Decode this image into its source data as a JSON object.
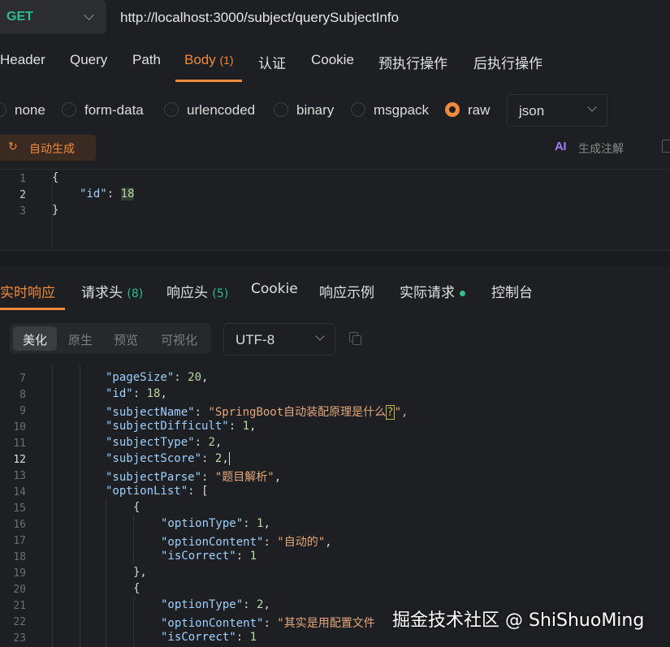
{
  "request": {
    "method": "GET",
    "url": "http://localhost:3000/subject/querySubjectInfo"
  },
  "req_tabs": [
    {
      "label": "Header"
    },
    {
      "label": "Query"
    },
    {
      "label": "Path"
    },
    {
      "label": "Body",
      "count": "(1)",
      "active": true
    },
    {
      "label": "认证"
    },
    {
      "label": "Cookie"
    },
    {
      "label": "预执行操作"
    },
    {
      "label": "后执行操作"
    }
  ],
  "body_types": [
    {
      "label": "none"
    },
    {
      "label": "form-data"
    },
    {
      "label": "urlencoded"
    },
    {
      "label": "binary"
    },
    {
      "label": "msgpack"
    },
    {
      "label": "raw",
      "selected": true
    }
  ],
  "raw_format": "json",
  "auto_generate_label": "自动生成",
  "ai": {
    "icon_text": "AI",
    "label": "生成注解"
  },
  "request_body": {
    "line_numbers": [
      "1",
      "2",
      "3"
    ],
    "open_brace": "{",
    "key": "\"id\"",
    "colon": ": ",
    "value": "18",
    "close_brace": "}"
  },
  "resp_tabs": [
    {
      "label": "实时响应",
      "active": true
    },
    {
      "label": "请求头",
      "count": "(8)"
    },
    {
      "label": "响应头",
      "count": "(5)"
    },
    {
      "label": "Cookie"
    },
    {
      "label": "响应示例"
    },
    {
      "label": "实际请求",
      "dot": true
    },
    {
      "label": "控制台"
    }
  ],
  "view_modes": [
    "美化",
    "原生",
    "预览",
    "可视化"
  ],
  "active_view_mode": "美化",
  "encoding": "UTF-8",
  "response_lines": [
    {
      "n": "7",
      "key": "\"pageSize\"",
      "val": "20",
      "type": "num"
    },
    {
      "n": "8",
      "key": "\"id\"",
      "val": "18",
      "type": "num"
    },
    {
      "n": "9",
      "key": "\"subjectName\"",
      "val": "\"SpringBoot自动装配原理是什么",
      "q": "?",
      "tail": "\",",
      "type": "str"
    },
    {
      "n": "10",
      "key": "\"subjectDifficult\"",
      "val": "1",
      "type": "num"
    },
    {
      "n": "11",
      "key": "\"subjectType\"",
      "val": "2",
      "type": "num"
    },
    {
      "n": "12",
      "key": "\"subjectScore\"",
      "val": "2",
      "type": "num"
    },
    {
      "n": "13",
      "key": "\"subjectParse\"",
      "val": "\"题目解析\"",
      "type": "str"
    },
    {
      "n": "14",
      "key": "\"optionList\"",
      "val": "[",
      "type": "punct"
    },
    {
      "n": "15",
      "text": "{"
    },
    {
      "n": "16",
      "key": "\"optionType\"",
      "val": "1",
      "type": "num"
    },
    {
      "n": "17",
      "key": "\"optionContent\"",
      "val": "\"自动的\"",
      "type": "str"
    },
    {
      "n": "18",
      "key": "\"isCorrect\"",
      "val": "1",
      "type": "num",
      "last": true
    },
    {
      "n": "19",
      "text": "},"
    },
    {
      "n": "20",
      "text": "{"
    },
    {
      "n": "21",
      "key": "\"optionType\"",
      "val": "2",
      "type": "num"
    },
    {
      "n": "22",
      "key": "\"optionContent\"",
      "val": "\"其实是用配置文件",
      "type": "str",
      "last": true
    },
    {
      "n": "23",
      "key": "\"isCorrect\"",
      "val": "1",
      "type": "num",
      "last": true
    }
  ],
  "watermark": "掘金技术社区 @ ShiShuoMing",
  "colors": {
    "accent": "#f08a3c",
    "method": "#2fbe8a",
    "key": "#9fd0ff",
    "string": "#e3a77b",
    "number": "#b8d7a3"
  }
}
